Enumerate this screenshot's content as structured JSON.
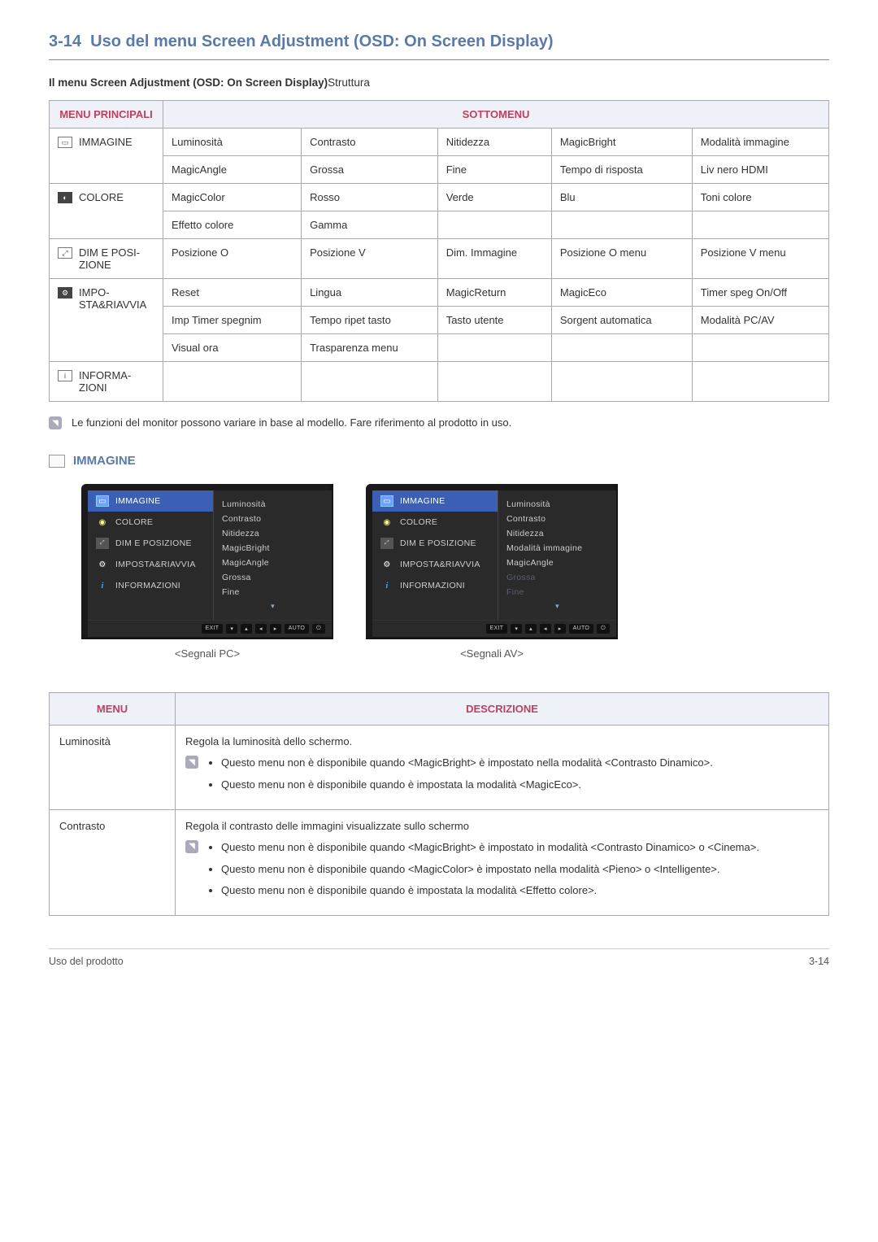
{
  "page": {
    "section_no": "3-14",
    "title": "Uso del menu Screen Adjustment (OSD: On Screen Display)",
    "subtitle_bold": "Il menu Screen Adjustment (OSD: On Screen Display)",
    "subtitle_plain": "Struttura",
    "footer_left": "Uso del prodotto",
    "footer_right": "3-14"
  },
  "table1": {
    "header_left": "MENU PRINCIPALI",
    "header_right": "SOTTOMENU",
    "rows": [
      {
        "main": "IMMAGINE",
        "cells": [
          [
            "Luminosità",
            "Contrasto",
            "Nitidezza",
            "MagicBright",
            "Modalità immagine"
          ],
          [
            "MagicAngle",
            "Grossa",
            "Fine",
            "Tempo di risposta",
            "Liv nero HDMI"
          ]
        ]
      },
      {
        "main": "COLORE",
        "cells": [
          [
            "MagicColor",
            "Rosso",
            "Verde",
            "Blu",
            "Toni colore"
          ],
          [
            "Effetto colore",
            "Gamma",
            "",
            "",
            ""
          ]
        ]
      },
      {
        "main": "DIM E POSIZIONE",
        "main_display": "DIM E POSI-\nZIONE",
        "cells": [
          [
            "Posizione O",
            "Posizione V",
            "Dim. Immagine",
            "Posizione O menu",
            "Posizione V menu"
          ]
        ]
      },
      {
        "main": "IMPOSTA&RIAVVIA",
        "main_display": "IMPO-\nSTA&RIAVVIA",
        "cells": [
          [
            "Reset",
            "Lingua",
            "MagicReturn",
            "MagicEco",
            "Timer speg On/Off"
          ],
          [
            "Imp Timer spegnim",
            "Tempo ripet tasto",
            "Tasto utente",
            "Sorgent automatica",
            "Modalità PC/AV"
          ],
          [
            "Visual ora",
            "Trasparenza menu",
            "",
            "",
            ""
          ]
        ]
      },
      {
        "main": "INFORMAZIONI",
        "main_display": "INFORMA-\nZIONI",
        "cells": [
          [
            "",
            "",
            "",
            "",
            ""
          ]
        ]
      }
    ]
  },
  "note1": "Le funzioni del monitor possono variare in base al modello. Fare riferimento al prodotto in uso.",
  "section_immagine": {
    "title": "IMMAGINE",
    "osd_left_items": [
      {
        "label": "IMMAGINE",
        "icon": "img",
        "selected": true
      },
      {
        "label": "COLORE",
        "icon": "col"
      },
      {
        "label": "DIM E POSIZIONE",
        "icon": "dim"
      },
      {
        "label": "IMPOSTA&RIAVVIA",
        "icon": "gear"
      },
      {
        "label": "INFORMAZIONI",
        "icon": "info"
      }
    ],
    "osd_pc_right": [
      "Luminosità",
      "Contrasto",
      "Nitidezza",
      "MagicBright",
      "MagicAngle",
      "Grossa",
      "Fine"
    ],
    "osd_av_right": [
      {
        "t": "Luminosità",
        "dim": false
      },
      {
        "t": "Contrasto",
        "dim": false
      },
      {
        "t": "Nitidezza",
        "dim": false
      },
      {
        "t": "Modalità immagine",
        "dim": false
      },
      {
        "t": "MagicAngle",
        "dim": false
      },
      {
        "t": "Grossa",
        "dim": true
      },
      {
        "t": "Fine",
        "dim": true
      }
    ],
    "osd_footer_btns": [
      "EXIT",
      "▾",
      "▴",
      "◂",
      "▸",
      "AUTO",
      "⏻"
    ],
    "caption_pc": "<Segnali PC>",
    "caption_av": "<Segnali AV>"
  },
  "table2": {
    "header_left": "MENU",
    "header_right": "DESCRIZIONE",
    "rows": [
      {
        "menu": "Luminosità",
        "intro": "Regola la luminosità dello schermo.",
        "bullets": [
          "Questo menu non è disponibile quando <MagicBright> è impostato nella modalità <Contrasto Dinamico>.",
          "Questo menu non è disponibile quando è impostata la modalità <MagicEco>."
        ]
      },
      {
        "menu": "Contrasto",
        "intro": "Regola il contrasto delle immagini visualizzate sullo schermo",
        "bullets": [
          "Questo menu non è disponibile quando <MagicBright> è impostato in modalità <Contrasto Dinamico> o <Cinema>.",
          "Questo menu non è disponibile quando <MagicColor> è impostato nella modalità <Pieno> o <Intelligente>.",
          "Questo menu non è disponibile quando è impostata la modalità <Effetto colore>."
        ]
      }
    ]
  }
}
